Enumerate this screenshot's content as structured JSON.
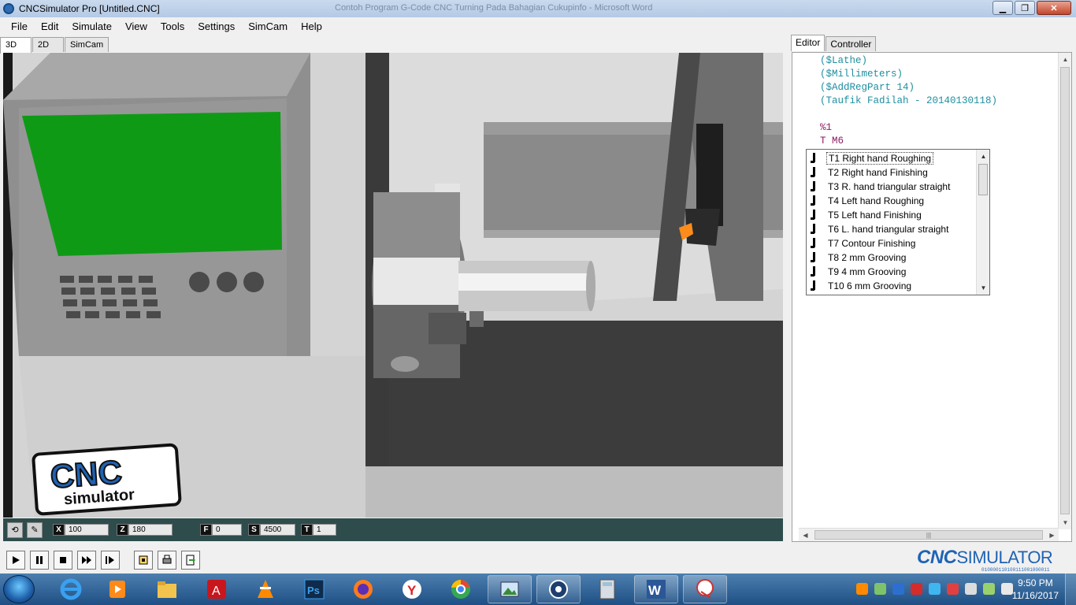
{
  "window": {
    "title": "CNCSimulator Pro [Untitled.CNC]",
    "background_title": "Contoh Program G-Code CNC Turning Pada Bahagian Cukupinfo - Microsoft Word",
    "minimize": "▁",
    "maximize": "❐",
    "close": "✕"
  },
  "menu": {
    "file": "File",
    "edit": "Edit",
    "simulate": "Simulate",
    "view": "View",
    "tools": "Tools",
    "settings": "Settings",
    "simcam": "SimCam",
    "help": "Help"
  },
  "view_tabs": {
    "tab_3d": "3D",
    "tab_2d": "2D",
    "tab_simcam": "SimCam"
  },
  "panel_tabs": {
    "editor": "Editor",
    "controller": "Controller"
  },
  "viewport": {
    "logo_top": "CNC",
    "logo_bottom": "simulator"
  },
  "coords": {
    "x_label": "X",
    "x_value": "100",
    "z_label": "Z",
    "z_value": "180",
    "f_label": "F",
    "f_value": "0",
    "s_label": "S",
    "s_value": "4500",
    "t_label": "T",
    "t_value": "1"
  },
  "editor": {
    "line1": "($Lathe)",
    "line2": "($Millimeters)",
    "line3": "($AddRegPart 14)",
    "line4": "(Taufik Fadilah - 20140130118)",
    "line6": "%1",
    "line7": "T M6"
  },
  "tool_list": {
    "selected_index": 0,
    "items": [
      "T1 Right hand Roughing",
      "T2 Right hand Finishing",
      "T3 R. hand triangular straight",
      "T4 Left hand Roughing",
      "T5 Left hand Finishing",
      "T6 L. hand triangular straight",
      "T7 Contour Finishing",
      "T8 2 mm Grooving",
      "T9 4 mm Grooving",
      "T10 6 mm Grooving"
    ]
  },
  "brand": {
    "main_bold": "CNC",
    "main_light": "SIMULATOR",
    "bits": "010000110100111001000011"
  },
  "taskbar": {
    "time": "9:50 PM",
    "date": "11/16/2017"
  },
  "colors": {
    "accent_blue": "#1f63b4",
    "code_teal": "#1e8fa0",
    "code_purple": "#8b1c62",
    "screen_green": "#0f9a16",
    "tool_orange": "#ff8c1a"
  }
}
